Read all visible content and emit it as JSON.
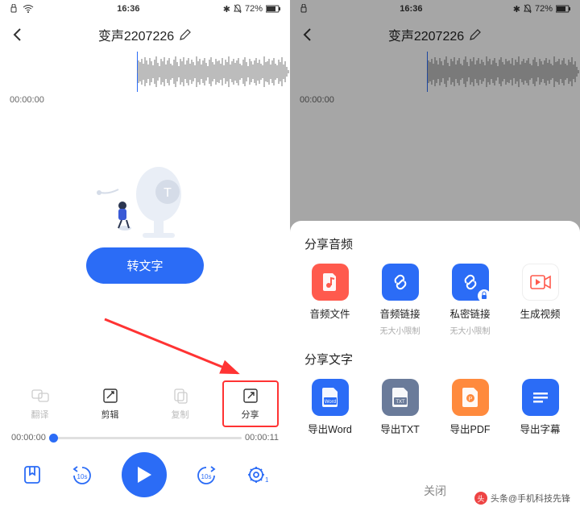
{
  "status": {
    "time": "16:36",
    "battery": "72%",
    "bt_bell_batt": "✱ 🔔 72% ▮"
  },
  "nav": {
    "title": "变声2207226"
  },
  "timeline": {
    "stamp": "00:00:00",
    "start": "00:00:00",
    "end": "00:00:11"
  },
  "main_button": "转文字",
  "ops": {
    "translate": "翻译",
    "edit": "剪辑",
    "copy": "复制",
    "share": "分享"
  },
  "play": {
    "back10": "10s",
    "fwd10": "10s",
    "speed": "1x"
  },
  "sheet": {
    "section1": "分享音频",
    "audio_file": "音频文件",
    "audio_link": "音频链接",
    "audio_link_sub": "无大小限制",
    "private_link": "私密链接",
    "private_link_sub": "无大小限制",
    "gen_video": "生成视频",
    "section2": "分享文字",
    "word": "导出Word",
    "txt": "导出TXT",
    "pdf": "导出PDF",
    "subtitle": "导出字幕",
    "close": "关闭"
  },
  "credit": "头条@手机科技先锋"
}
